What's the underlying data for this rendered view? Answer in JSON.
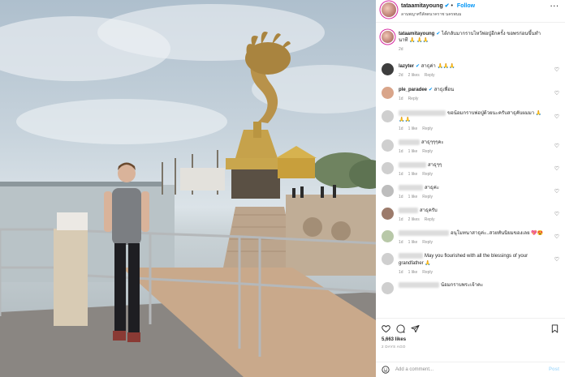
{
  "header": {
    "username": "tataamitayoung",
    "verified_icon": "verified-badge-icon",
    "follow_label": "Follow",
    "location": "ลานพญาศรีสัตตนาคราช นครพนม",
    "more_icon": "more-options-icon"
  },
  "caption": {
    "username": "tataamitayoung",
    "text": "ได้กลับมากราบไหว้พ่อปู่อีกครั้ง ขอพรก่อนขึ้นทำนาที 🙏 🙏🙏",
    "time": "2d"
  },
  "comments": [
    {
      "username": "lazyter",
      "text": "สาธุค่า 🙏🙏🙏",
      "time": "2d",
      "likes": "2 likes",
      "reply": "Reply",
      "avatar_color": "#3d3d3d"
    },
    {
      "username": "ple_paradee",
      "text": "สาธุเพื่อน",
      "time": "1d",
      "likes": "",
      "reply": "Reply",
      "avatar_color": "#d9a58a"
    },
    {
      "username": "",
      "text": "ขอน้อมกราบพ่อปู่ด้วยนะครับสาธุคับผมมา 🙏 🙏🙏",
      "time": "1d",
      "likes": "1 like",
      "reply": "Reply",
      "avatar_color": "#cfcfcf"
    },
    {
      "username": "",
      "text": "สาธุๆๆๆคะ",
      "time": "1d",
      "likes": "1 like",
      "reply": "Reply",
      "avatar_color": "#cfcfcf"
    },
    {
      "username": "",
      "text": "สาธุๆๆ",
      "time": "1d",
      "likes": "1 like",
      "reply": "Reply",
      "avatar_color": "#cfcfcf"
    },
    {
      "username": "",
      "text": "สาธุค่ะ",
      "time": "1d",
      "likes": "1 like",
      "reply": "Reply",
      "avatar_color": "#bdbdbd"
    },
    {
      "username": "",
      "text": "สาธุครับ",
      "time": "1d",
      "likes": "2 likes",
      "reply": "Reply",
      "avatar_color": "#9c7b6b"
    },
    {
      "username": "",
      "text": "อนุโมทนาสาธุค่ะ..สวยทันนิยมของเลย 💖😍",
      "time": "1d",
      "likes": "1 like",
      "reply": "Reply",
      "avatar_color": "#b8c8a8"
    },
    {
      "username": "",
      "text": "May you flourished with all the blessings of your grandfather 🙏",
      "time": "1d",
      "likes": "1 like",
      "reply": "Reply",
      "avatar_color": "#cfcfcf"
    },
    {
      "username": "",
      "text": "น้อมกราบพระเจ้าคะ",
      "time": "",
      "likes": "",
      "reply": "",
      "avatar_color": "#cfcfcf"
    }
  ],
  "actions": {
    "like_icon": "heart-icon",
    "comment_icon": "comment-icon",
    "share_icon": "share-icon",
    "save_icon": "bookmark-icon"
  },
  "likes": "5,663 likes",
  "posted": "2 DAYS AGO",
  "add_comment": {
    "placeholder": "Add a comment...",
    "post_label": "Post",
    "emoji_icon": "emoji-icon"
  }
}
